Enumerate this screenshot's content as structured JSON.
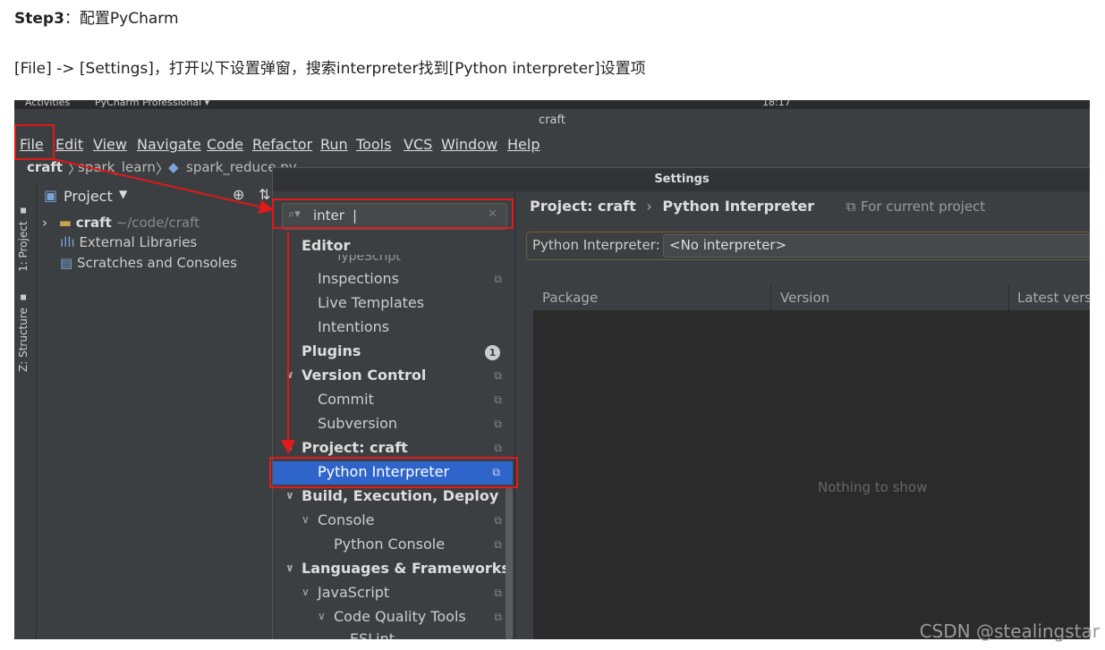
{
  "article": {
    "step_label": "Step3",
    "step_text": "：配置PyCharm",
    "description": "[File] -> [Settings]，打开以下设置弹窗，搜索interpreter找到[Python interpreter]设置项"
  },
  "topbar": {
    "activities": "Activities",
    "app": "PyCharm Professional ▾",
    "clock": "18:17"
  },
  "window": {
    "title": "craft"
  },
  "menu": [
    "File",
    "Edit",
    "View",
    "Navigate",
    "Code",
    "Refactor",
    "Run",
    "Tools",
    "VCS",
    "Window",
    "Help"
  ],
  "breadcrumb": {
    "project": "craft",
    "folder": "spark_learn",
    "file": "spark_reduce.py"
  },
  "toolwindows": {
    "project": "1: Project",
    "structure": "Z: Structure"
  },
  "project_panel": {
    "title": "Project",
    "root_name": "craft",
    "root_path": "~/code/craft",
    "external": "External Libraries",
    "scratches": "Scratches and Consoles"
  },
  "settings": {
    "title": "Settings",
    "search_value": "inter",
    "nav": [
      {
        "label": "Editor",
        "bold": true
      },
      {
        "label": "TypeScript"
      },
      {
        "label": "Inspections"
      },
      {
        "label": "Live Templates"
      },
      {
        "label": "Intentions"
      },
      {
        "label": "Plugins",
        "badge": "1"
      },
      {
        "label": "Version Control"
      },
      {
        "label": "Commit"
      },
      {
        "label": "Subversion"
      },
      {
        "label": "Project: craft"
      },
      {
        "label": "Python Interpreter"
      },
      {
        "label": "Build, Execution, Deploymen"
      },
      {
        "label": "Console"
      },
      {
        "label": "Python Console"
      },
      {
        "label": "Languages & Frameworks"
      },
      {
        "label": "JavaScript"
      },
      {
        "label": "Code Quality Tools"
      },
      {
        "label": "ESLint"
      }
    ],
    "right": {
      "crumb_project": "Project: craft",
      "crumb_sep": "›",
      "crumb_page": "Python Interpreter",
      "scope_note": "For current project",
      "interpreter_label": "Python Interpreter:",
      "interpreter_value": "<No interpreter>",
      "columns": [
        "Package",
        "Version",
        "Latest versi"
      ],
      "empty_text": "Nothing to show"
    }
  },
  "watermark": "CSDN @stealingstar",
  "colors": {
    "highlight": "#e0191a",
    "selection": "#2f65ca",
    "ide_bg": "#3c3f41"
  }
}
